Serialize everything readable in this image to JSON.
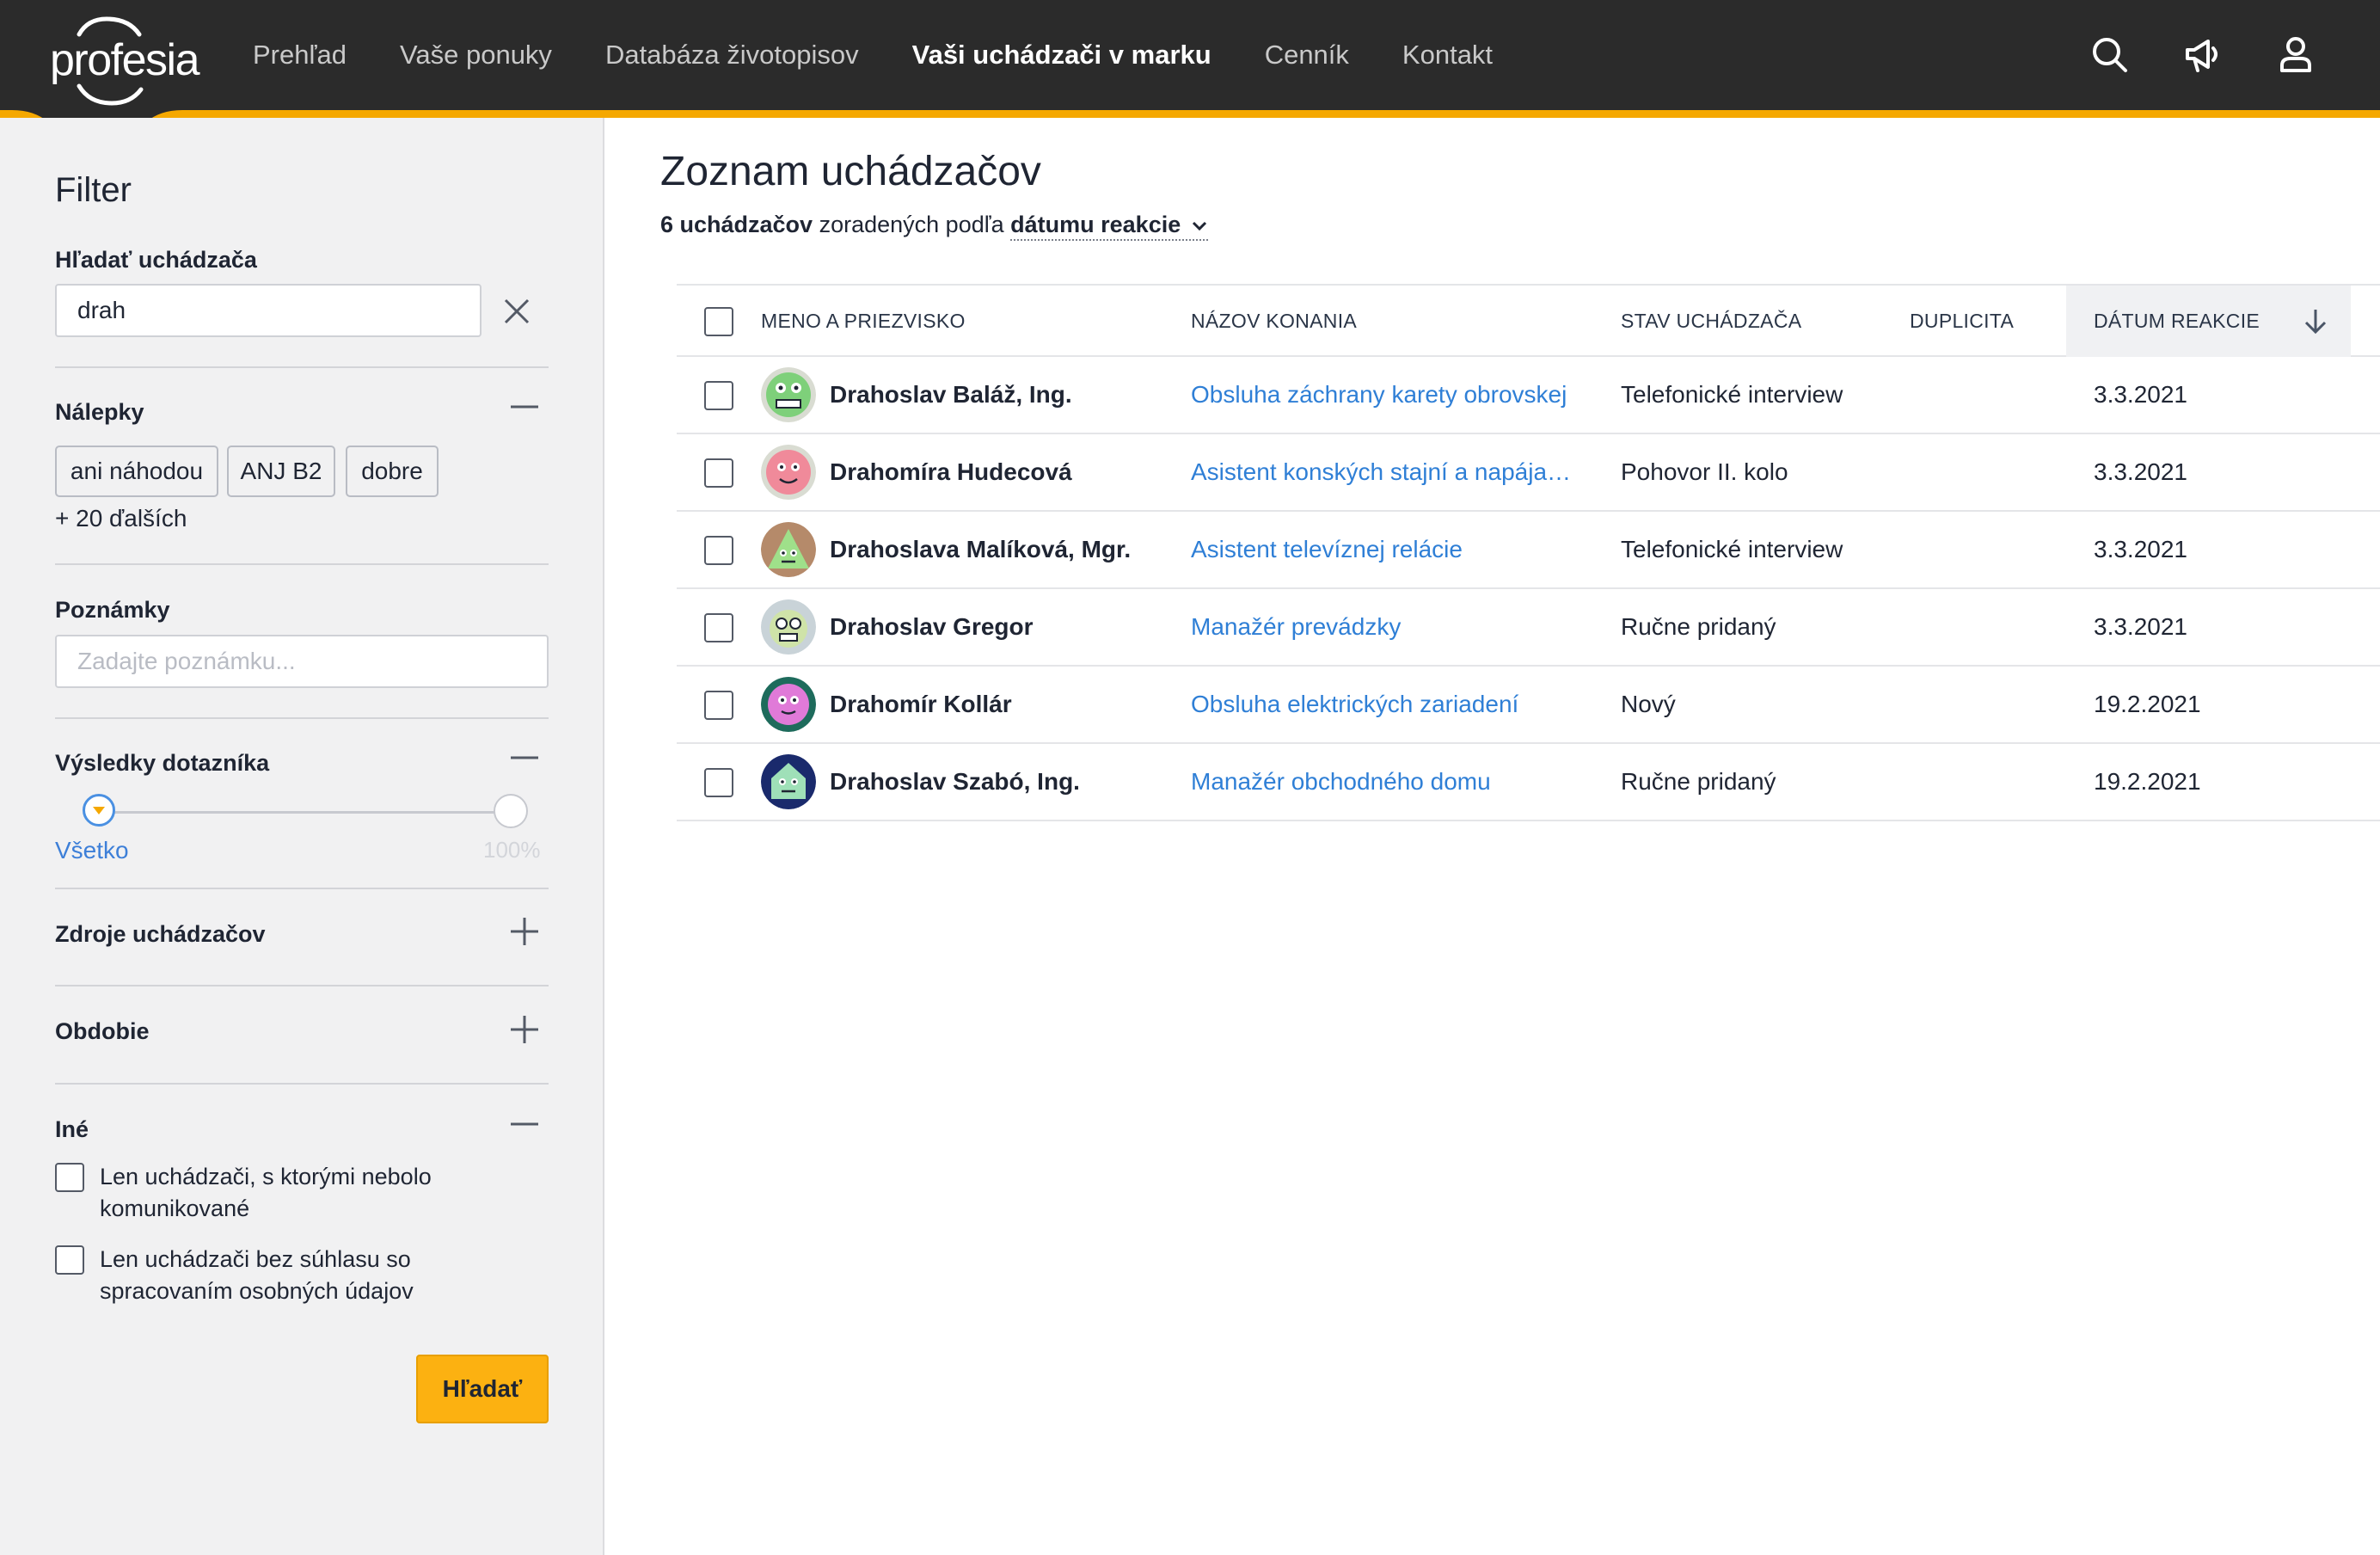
{
  "header": {
    "logo": "profesia",
    "nav": [
      {
        "label": "Prehľad",
        "active": false
      },
      {
        "label": "Vaše ponuky",
        "active": false
      },
      {
        "label": "Databáza životopisov",
        "active": false
      },
      {
        "label": "Vaši uchádzači v marku",
        "active": true
      },
      {
        "label": "Cenník",
        "active": false
      },
      {
        "label": "Kontakt",
        "active": false
      }
    ],
    "icons": [
      "search-icon",
      "megaphone-icon",
      "user-icon"
    ],
    "accent_color": "#f5a800"
  },
  "filter": {
    "title": "Filter",
    "search": {
      "label": "Hľadať uchádzača",
      "value": "drah"
    },
    "tags": {
      "label": "Nálepky",
      "items": [
        "ani náhodou",
        "ANJ B2",
        "dobre"
      ],
      "more": "+ 20 ďalších"
    },
    "notes": {
      "label": "Poznámky",
      "placeholder": "Zadajte poznámku..."
    },
    "survey": {
      "label": "Výsledky dotazníka",
      "min_label": "Všetko",
      "max_label": "100%"
    },
    "sources": {
      "label": "Zdroje uchádzačov"
    },
    "period": {
      "label": "Obdobie"
    },
    "other": {
      "label": "Iné",
      "options": [
        "Len uchádzači, s ktorými nebolo komunikované",
        "Len uchádzači bez súhlasu so spracovaním osobných údajov"
      ]
    },
    "search_button": "Hľadať"
  },
  "main": {
    "title": "Zoznam uchádzačov",
    "count": "6 uchádzačov",
    "sorted_by_text": "zoradených podľa",
    "sort_value": "dátumu reakcie",
    "columns": [
      "MENO A PRIEZVISKO",
      "NÁZOV KONANIA",
      "STAV UCHÁDZAČA",
      "DUPLICITA",
      "DÁTUM REAKCIE"
    ],
    "rows": [
      {
        "name": "Drahoslav Baláž, Ing.",
        "job": "Obsluha záchrany karety obrovskej",
        "status": "Telefonické interview",
        "duplicate": "",
        "date": "3.3.2021",
        "avatar_color": "#7ed07a"
      },
      {
        "name": "Drahomíra Hudecová",
        "job": "Asistent konských stajní a napája…",
        "status": "Pohovor II. kolo",
        "duplicate": "",
        "date": "3.3.2021",
        "avatar_color": "#f08a9a"
      },
      {
        "name": "Drahoslava Malíková, Mgr.",
        "job": "Asistent televíznej relácie",
        "status": "Telefonické interview",
        "duplicate": "",
        "date": "3.3.2021",
        "avatar_color": "#9fe08a"
      },
      {
        "name": "Drahoslav Gregor",
        "job": "Manažér prevádzky",
        "status": "Ručne pridaný",
        "duplicate": "",
        "date": "3.3.2021",
        "avatar_color": "#cfe3a8"
      },
      {
        "name": "Drahomír Kollár",
        "job": "Obsluha elektrických zariadení",
        "status": "Nový",
        "duplicate": "",
        "date": "19.2.2021",
        "avatar_color": "#e07ad8"
      },
      {
        "name": "Drahoslav Szabó, Ing.",
        "job": "Manažér obchodného domu",
        "status": "Ručne pridaný",
        "duplicate": "",
        "date": "19.2.2021",
        "avatar_color": "#9fe0b8"
      }
    ]
  }
}
